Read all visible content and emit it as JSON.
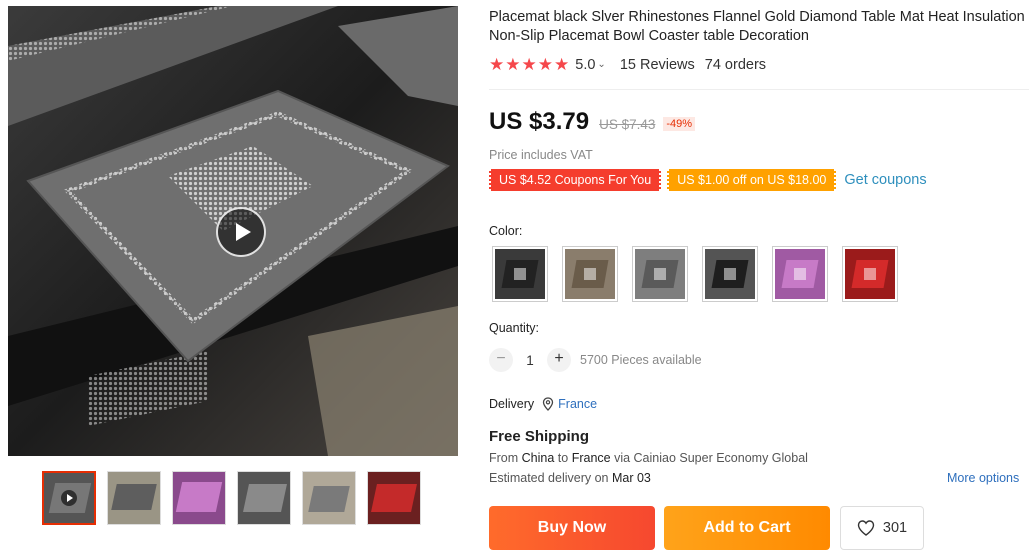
{
  "product": {
    "title": "Placemat black Slver Rhinestones Flannel Gold Diamond Table Mat Heat Insulation Non-Slip Placemat Bowl Coaster table Decoration",
    "rating": "5.0",
    "rating_stars": 5,
    "reviews": "15 Reviews",
    "orders": "74 orders"
  },
  "price": {
    "current": "US $3.79",
    "original": "US $7.43",
    "discount": "-49%",
    "vat_note": "Price includes VAT"
  },
  "coupons": {
    "coupon_1": "US $4.52 Coupons For You",
    "coupon_2": "US $1.00 off on US $18.00",
    "get_coupons": "Get coupons"
  },
  "color": {
    "label": "Color:",
    "swatches": [
      {
        "name": "black",
        "bg": "#3a3a3a",
        "mat": "#222"
      },
      {
        "name": "gold",
        "bg": "#8a7d6c",
        "mat": "#6a5c4a"
      },
      {
        "name": "silver",
        "bg": "#7e7e7e",
        "mat": "#5a5a5a"
      },
      {
        "name": "black-silver",
        "bg": "#545454",
        "mat": "#1e1e1e"
      },
      {
        "name": "purple",
        "bg": "#a05aa3",
        "mat": "#c77ac7"
      },
      {
        "name": "red",
        "bg": "#9b1b1b",
        "mat": "#d42a2a"
      }
    ]
  },
  "quantity": {
    "label": "Quantity:",
    "value": "1",
    "minus": "−",
    "plus": "+",
    "available": "5700 Pieces available"
  },
  "delivery": {
    "label": "Delivery",
    "destination": "France"
  },
  "shipping": {
    "title": "Free Shipping",
    "from_prefix": "From ",
    "from": "China",
    "to_prefix": " to ",
    "to": "France",
    "via": " via Cainiao Super Economy Global",
    "est_prefix": "Estimated delivery on ",
    "est_date": "Mar 03",
    "more_options": "More options"
  },
  "actions": {
    "buy_now": "Buy Now",
    "add_to_cart": "Add to Cart",
    "wishlist_count": "301"
  },
  "colors": {
    "accent_red": "#f5474b",
    "link_blue": "#2e6fbd",
    "buy_now": "#f6482f",
    "add_to_cart": "#ff8a00"
  }
}
